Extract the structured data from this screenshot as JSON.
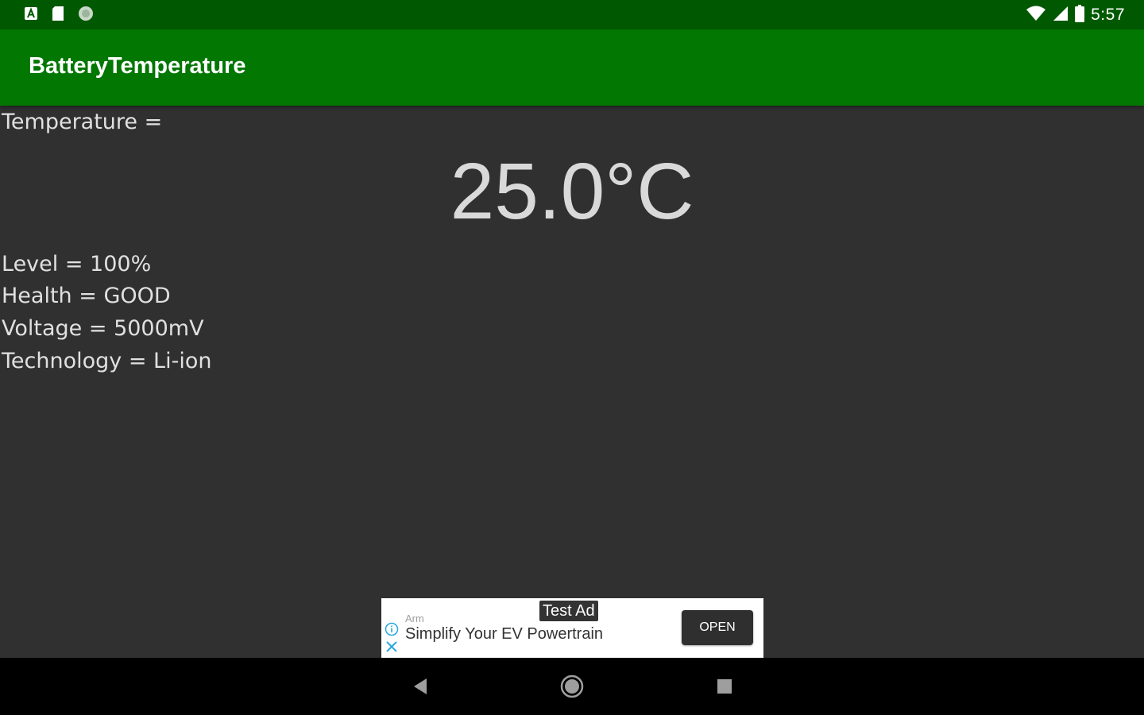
{
  "status_bar": {
    "time": "5:57",
    "left_icons": [
      "notification-a-icon",
      "sd-card-icon",
      "circle-notification-icon"
    ],
    "right_icons": [
      "wifi-icon",
      "cell-signal-icon",
      "battery-icon"
    ]
  },
  "app_bar": {
    "title": "BatteryTemperature"
  },
  "content": {
    "temperature_label": "Temperature =",
    "temperature_value": "25.0°C",
    "level": "Level = 100%",
    "health": "Health = GOOD",
    "voltage": "Voltage = 5000mV",
    "technology": "Technology = Li-ion"
  },
  "ad": {
    "badge": "Test Ad",
    "advertiser": "Arm",
    "headline": "Simplify Your EV Powertrain",
    "cta": "OPEN"
  },
  "nav_bar": {
    "icons": [
      "back-icon",
      "home-icon",
      "recents-icon"
    ]
  },
  "colors": {
    "status_bar": "#005900",
    "app_bar": "#027702",
    "background": "#303030",
    "nav_bar": "#000000",
    "ad_accent": "#29a8e0"
  }
}
